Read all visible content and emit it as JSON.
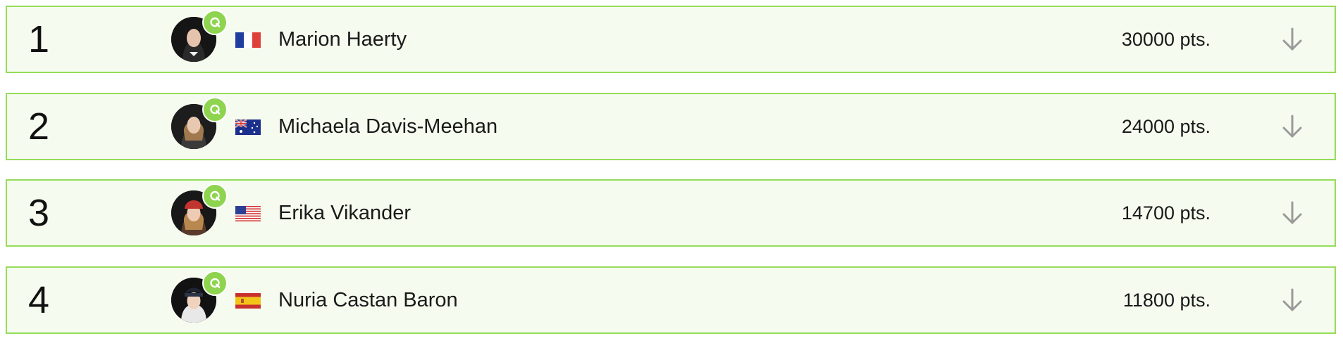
{
  "colors": {
    "row_border": "#96dc5a",
    "row_background": "#f5fbee",
    "badge_green": "#8ed44f",
    "arrow_gray": "#9a9a9a"
  },
  "badge": {
    "label": "Q",
    "icon": "qualified-badge-icon"
  },
  "expand_icon": "arrow-down-icon",
  "rankings": [
    {
      "rank": "1",
      "name": "Marion Haerty",
      "points": "30000 pts.",
      "country_flag": "flag-france-icon"
    },
    {
      "rank": "2",
      "name": "Michaela Davis-Meehan",
      "points": "24000 pts.",
      "country_flag": "flag-australia-icon"
    },
    {
      "rank": "3",
      "name": "Erika Vikander",
      "points": "14700 pts.",
      "country_flag": "flag-usa-icon"
    },
    {
      "rank": "4",
      "name": "Nuria Castan Baron",
      "points": "11800 pts.",
      "country_flag": "flag-spain-icon"
    }
  ]
}
